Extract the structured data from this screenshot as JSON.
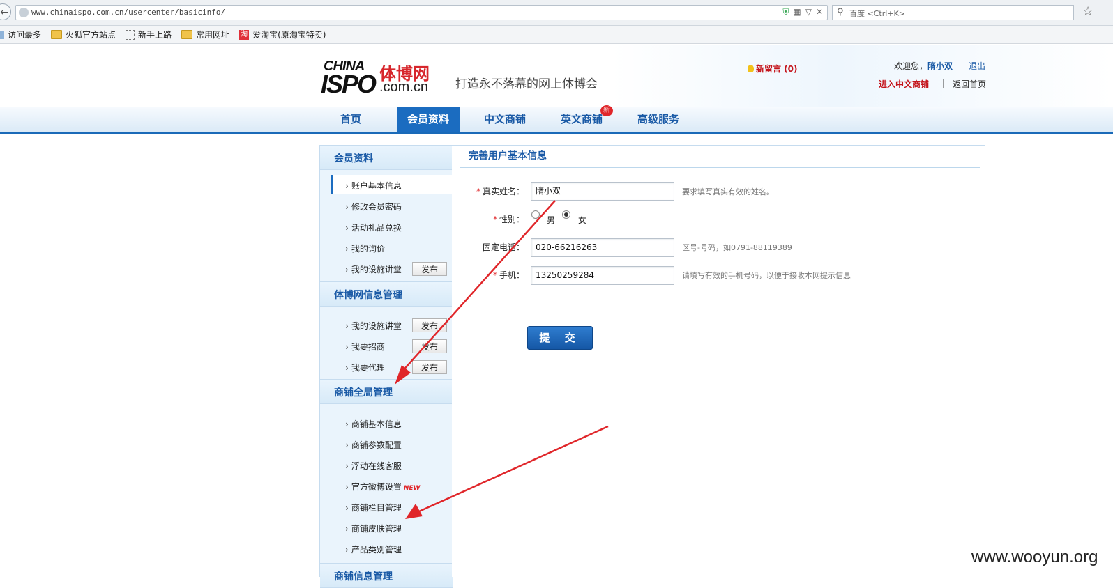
{
  "browser": {
    "url": "www.chinaispo.com.cn/usercenter/basicinfo/",
    "search_placeholder": "百度 <Ctrl+K>",
    "bookmarks": [
      "访问最多",
      "火狐官方站点",
      "新手上路",
      "常用网址",
      "爱淘宝(原淘宝特卖)"
    ]
  },
  "header": {
    "logo_top": "CHINA",
    "logo_main": "ISPO",
    "logo_cn": "体博网",
    "logo_domain": ".com.cn",
    "slogan": "打造永不落幕的网上体博会",
    "new_message": "新留言 (0)",
    "welcome_prefix": "欢迎您，",
    "username": "隋小双",
    "logout": "退出",
    "enter_shop": "进入中文商铺",
    "separator": "|",
    "back_home": "返回首页"
  },
  "nav": {
    "items": [
      "首页",
      "会员资料",
      "中文商铺",
      "英文商铺",
      "高级服务"
    ],
    "active_index": 1,
    "new_badge": "新"
  },
  "sidebar": {
    "section1": {
      "title": "会员资料",
      "items": [
        "账户基本信息",
        "修改会员密码",
        "活动礼品兑换",
        "我的询价",
        "我的设施讲堂"
      ]
    },
    "section2": {
      "title": "体博网信息管理",
      "items": [
        "我的设施讲堂",
        "我要招商",
        "我要代理"
      ]
    },
    "section3": {
      "title": "商铺全局管理",
      "items": [
        "商铺基本信息",
        "商铺参数配置",
        "浮动在线客服",
        "官方微博设置",
        "商铺栏目管理",
        "商铺皮肤管理",
        "产品类别管理"
      ],
      "new_tag": "NEW"
    },
    "section4": {
      "title": "商铺信息管理"
    },
    "publish_label": "发布"
  },
  "form": {
    "title": "完善用户基本信息",
    "required_mark": "*",
    "name_label": "真实姓名：",
    "name_value": "隋小双",
    "name_hint": "要求填写真实有效的姓名。",
    "gender_label": "性别：",
    "gender_male": "男",
    "gender_female": "女",
    "gender_selected": "女",
    "phone_label": "固定电话：",
    "phone_value": "020-66216263",
    "phone_hint": "区号-号码，如0791-88119389",
    "mobile_label": "手机：",
    "mobile_value": "13250259284",
    "mobile_hint": "请填写有效的手机号码，以便于接收本网提示信息",
    "submit": "提 交"
  },
  "colors": {
    "brand_blue": "#1b6cc0",
    "link_blue": "#1a5aa6",
    "alert_red": "#e0262a",
    "annotation_arrow": "#e0262a"
  },
  "watermark": "www.wooyun.org"
}
